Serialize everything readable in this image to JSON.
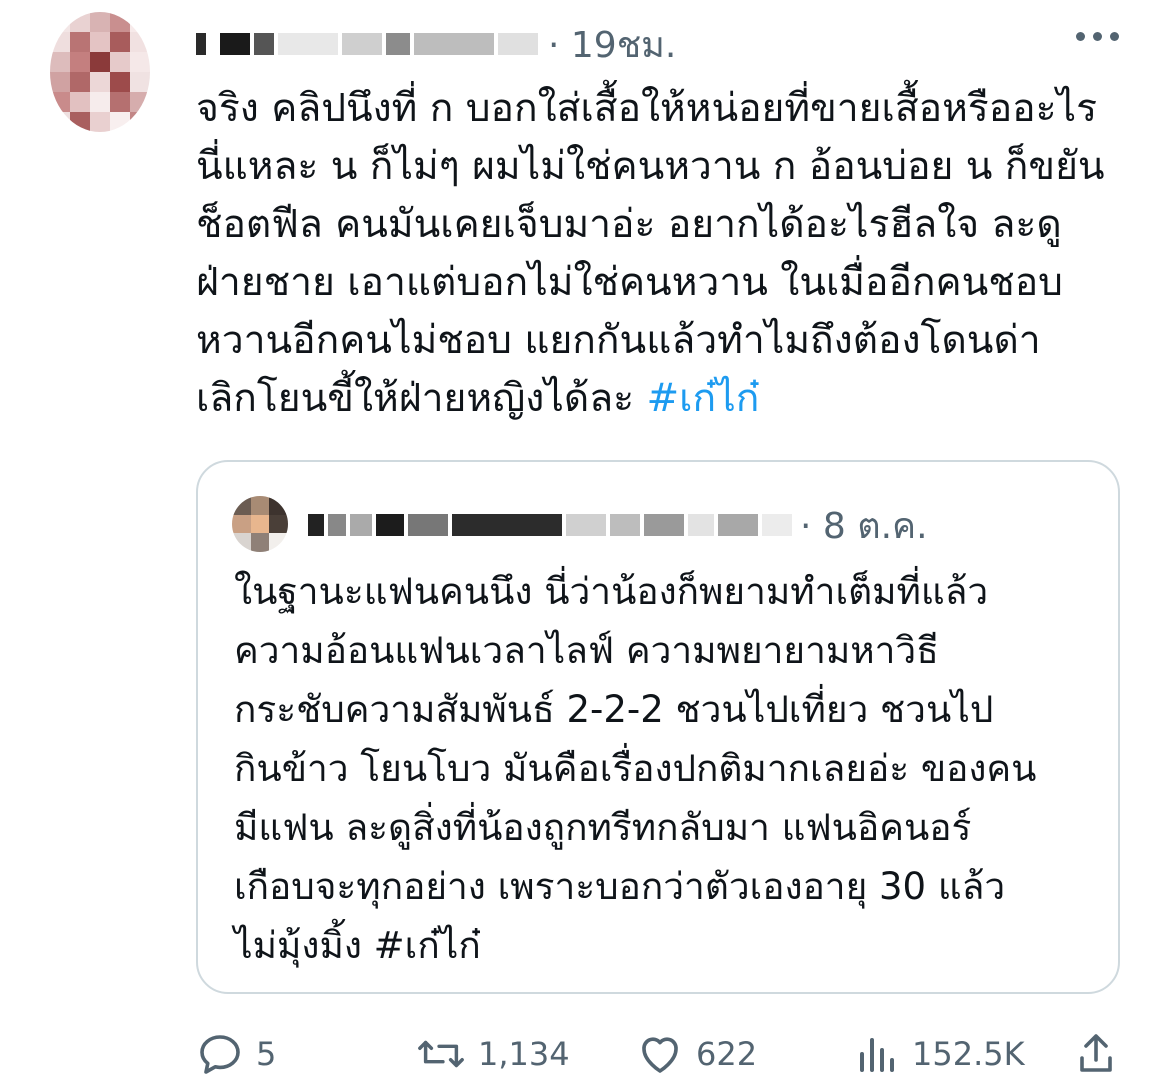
{
  "tweet": {
    "author_time": "· 19ชม.",
    "text_lines": [
      "จริง คลิปนึงที่ ก บอกใส่เสื้อให้หน่อยที่ขายเสื้อหรืออะไร",
      "นี่แหละ น ก็ไม่ๆ ผมไม่ใช่คนหวาน ก อ้อนบ่อย น ก็ขยัน",
      "ช็อตฟีล คนมันเคยเจ็บมาอ่ะ อยากได้อะไรฮีลใจ ละดู",
      "ฝ่ายชาย เอาแต่บอกไม่ใช่คนหวาน ในเมื่ออีกคนชอบ",
      "หวานอีกคนไม่ชอบ แยกกันแล้วทำไมถึงต้องโดนด่า"
    ],
    "last_line": "เลิกโยนขี้ให้ฝ่ายหญิงได้ละ ",
    "hashtag": "#เก๋ไก๋"
  },
  "quote": {
    "time": "· 8 ต.ค.",
    "text": "ในฐานะแฟนคนนึง นี่ว่าน้องก็พยามทำเต็มที่แล้ว\nความอ้อนแฟนเวลาไลฟ์ ความพยายามหาวิธี\nกระชับความสัมพันธ์ 2-2-2 ชวนไปเที่ยว ชวนไป\nกินข้าว โยนโบว มันคือเรื่องปกติมากเลยอ่ะ ของคน\nมีแฟน ละดูสิ่งที่น้องถูกทรีทกลับมา แฟนอิคนอร์\nเกือบจะทุกอย่าง เพราะบอกว่าตัวเองอายุ 30 แล้ว\nไม่มุ้งมิ้ง #เก๋ไก๋"
  },
  "actions": {
    "replies": "5",
    "retweets": "1,134",
    "likes": "622",
    "views": "152.5K"
  },
  "icons": [
    "reply-icon",
    "retweet-icon",
    "like-icon",
    "views-icon",
    "share-icon",
    "more-icon"
  ],
  "colors": {
    "text": "#0f1419",
    "secondary": "#536471",
    "link": "#1d9bf0",
    "border": "#cfd9de"
  }
}
